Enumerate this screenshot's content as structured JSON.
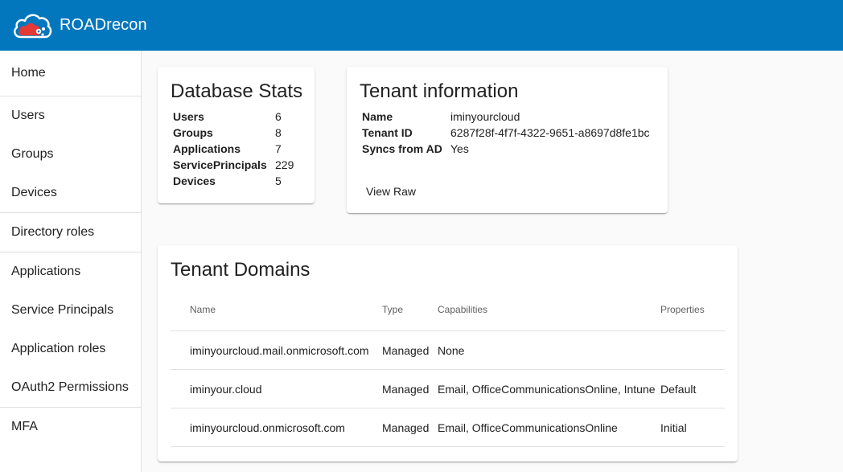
{
  "header": {
    "title": "ROADrecon",
    "logo_icon": "cloud-logo-icon"
  },
  "colors": {
    "header_bg": "#0277bd",
    "logo_red": "#e53935"
  },
  "sidebar": {
    "items": [
      {
        "label": "Home"
      },
      {
        "label": "Users"
      },
      {
        "label": "Groups"
      },
      {
        "label": "Devices"
      },
      {
        "label": "Directory roles"
      },
      {
        "label": "Applications"
      },
      {
        "label": "Service Principals"
      },
      {
        "label": "Application roles"
      },
      {
        "label": "OAuth2 Permissions"
      },
      {
        "label": "MFA"
      }
    ]
  },
  "db_stats": {
    "title": "Database Stats",
    "rows": [
      {
        "label": "Users",
        "value": "6"
      },
      {
        "label": "Groups",
        "value": "8"
      },
      {
        "label": "Applications",
        "value": "7"
      },
      {
        "label": "ServicePrincipals",
        "value": "229"
      },
      {
        "label": "Devices",
        "value": "5"
      }
    ]
  },
  "tenant_info": {
    "title": "Tenant information",
    "rows": [
      {
        "label": "Name",
        "value": "iminyourcloud"
      },
      {
        "label": "Tenant ID",
        "value": "6287f28f-4f7f-4322-9651-a8697d8fe1bc"
      },
      {
        "label": "Syncs from AD",
        "value": "Yes"
      }
    ],
    "view_raw_label": "View Raw"
  },
  "tenant_domains": {
    "title": "Tenant Domains",
    "columns": {
      "name": "Name",
      "type": "Type",
      "capabilities": "Capabilities",
      "properties": "Properties"
    },
    "rows": [
      {
        "name": "iminyourcloud.mail.onmicrosoft.com",
        "type": "Managed",
        "capabilities": "None",
        "properties": ""
      },
      {
        "name": "iminyour.cloud",
        "type": "Managed",
        "capabilities": "Email, OfficeCommunicationsOnline, Intune",
        "properties": "Default"
      },
      {
        "name": "iminyourcloud.onmicrosoft.com",
        "type": "Managed",
        "capabilities": "Email, OfficeCommunicationsOnline",
        "properties": "Initial"
      }
    ]
  }
}
